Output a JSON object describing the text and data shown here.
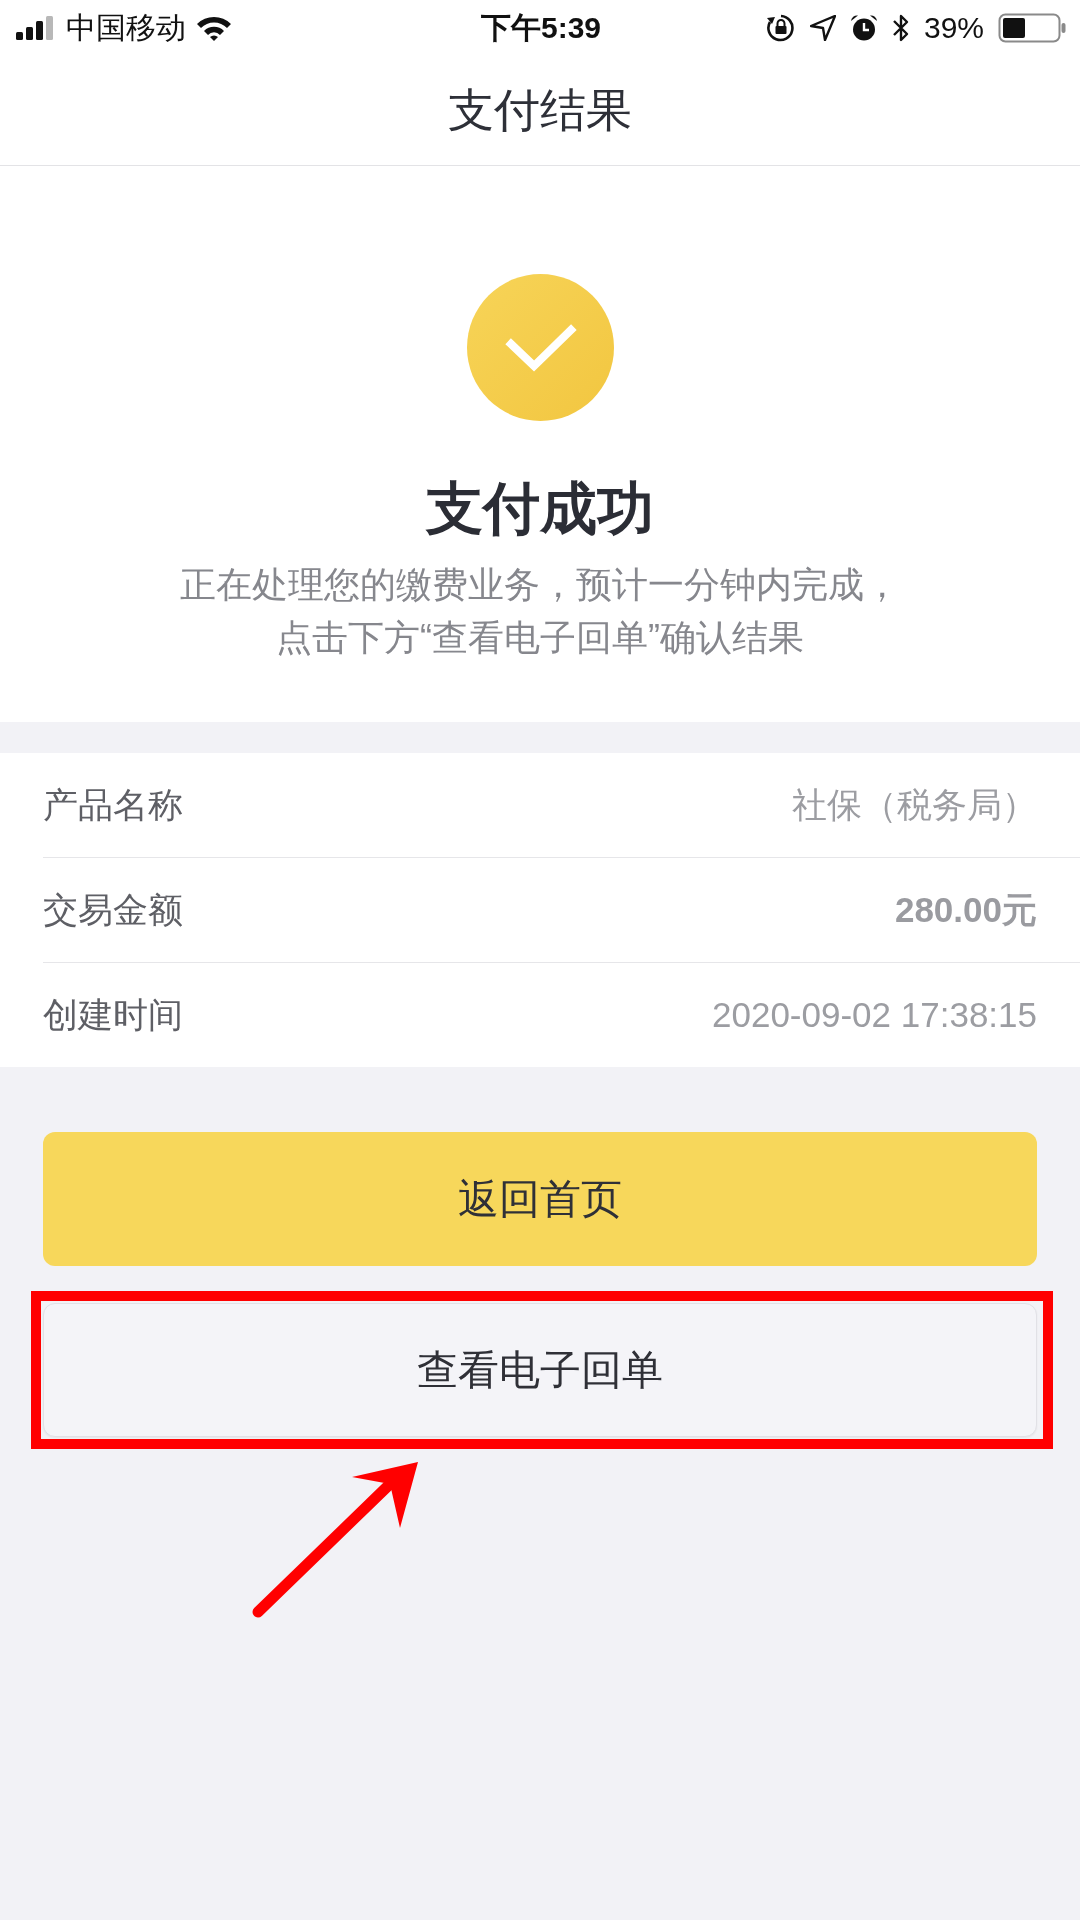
{
  "status_bar": {
    "carrier": "中国移动",
    "time": "下午5:39",
    "battery_percent": "39%"
  },
  "header": {
    "title": "支付结果"
  },
  "result": {
    "title": "支付成功",
    "message": "正在处理您的缴费业务，预计一分钟内完成，点击下方“查看电子回单”确认结果"
  },
  "details": [
    {
      "label": "产品名称",
      "value": "社保（税务局）",
      "emphasized": false
    },
    {
      "label": "交易金额",
      "value": "280.00元",
      "emphasized": true
    },
    {
      "label": "创建时间",
      "value": "2020-09-02 17:38:15",
      "emphasized": false
    }
  ],
  "buttons": [
    {
      "label": "返回首页",
      "kind": "primary",
      "highlighted": false
    },
    {
      "label": "查看电子回单",
      "kind": "secondary",
      "highlighted": true
    }
  ]
}
